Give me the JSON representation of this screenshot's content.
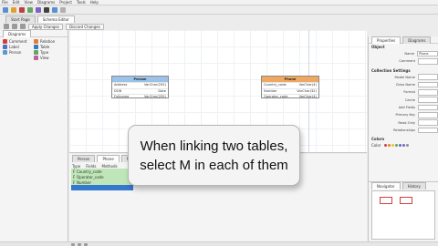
{
  "menu": [
    "File",
    "Edit",
    "View",
    "Diagrams",
    "Project",
    "Tools",
    "Help"
  ],
  "toolbar": {
    "icon_colors": [
      "#5a8fd0",
      "#e0a030",
      "#c04040",
      "#60a860",
      "#8060c0",
      "#404040",
      "#5a8fd0",
      "#b0b0b0"
    ]
  },
  "doc_tabs": [
    "Start Page",
    "Schema Editor"
  ],
  "editor_toolbar": {
    "apply_label": "Apply Changes",
    "discard_label": "Discard Changes"
  },
  "left_panel": {
    "tab_label": "Diagrams",
    "items": [
      {
        "label": "Comment",
        "color": "#d04040"
      },
      {
        "label": "Label",
        "color": "#5070c0"
      },
      {
        "label": "Person",
        "color": "#5a9ad0"
      },
      {
        "label": "Relation",
        "color": "#e08030"
      },
      {
        "label": "Table",
        "color": "#3a7ac0"
      },
      {
        "label": "Type",
        "color": "#60a860"
      },
      {
        "label": "View",
        "color": "#c060a0"
      }
    ]
  },
  "entities": {
    "person": {
      "title": "Person",
      "rows": [
        {
          "field": "Address",
          "type": "VarChar(255)"
        },
        {
          "field": "DOB",
          "type": "Date"
        },
        {
          "field": "Fullname",
          "type": "VarChar(255)"
        }
      ]
    },
    "phone": {
      "title": "Phone",
      "rows": [
        {
          "field": "Country_code",
          "type": "VarChar(4)"
        },
        {
          "field": "Number",
          "type": "VarChar(32)"
        },
        {
          "field": "Operator_code",
          "type": "VarChar(4)"
        }
      ]
    }
  },
  "tooltip": {
    "line1": "When linking two tables,",
    "line2": "select M in each of them"
  },
  "bottom_panel": {
    "tabs": [
      "Person",
      "Phone",
      "Methods"
    ],
    "columns": [
      "Type",
      "Fields",
      "Methods"
    ],
    "rows": [
      "Country_code",
      "Operator_code",
      "Number"
    ]
  },
  "right_panel": {
    "tabs": [
      "Properties",
      "Diagrams"
    ],
    "section_object": "Object",
    "name_label": "Name",
    "name_value": "Phone",
    "comment_label": "Comment",
    "section_coll": "Collection Settings",
    "coll_fields": [
      "Model Name",
      "Class Name",
      "Format",
      "Cache",
      "Add Fields",
      "Primary Key",
      "Read-Only",
      "Relationships"
    ],
    "section_colors": "Colors",
    "color_label": "Color",
    "swatches": [
      "#d04040",
      "#e08030",
      "#f0c030",
      "#60a860",
      "#5070c0",
      "#8060c0",
      "#909090"
    ]
  },
  "nav_panel": {
    "tabs": [
      "Navigator",
      "History"
    ]
  }
}
